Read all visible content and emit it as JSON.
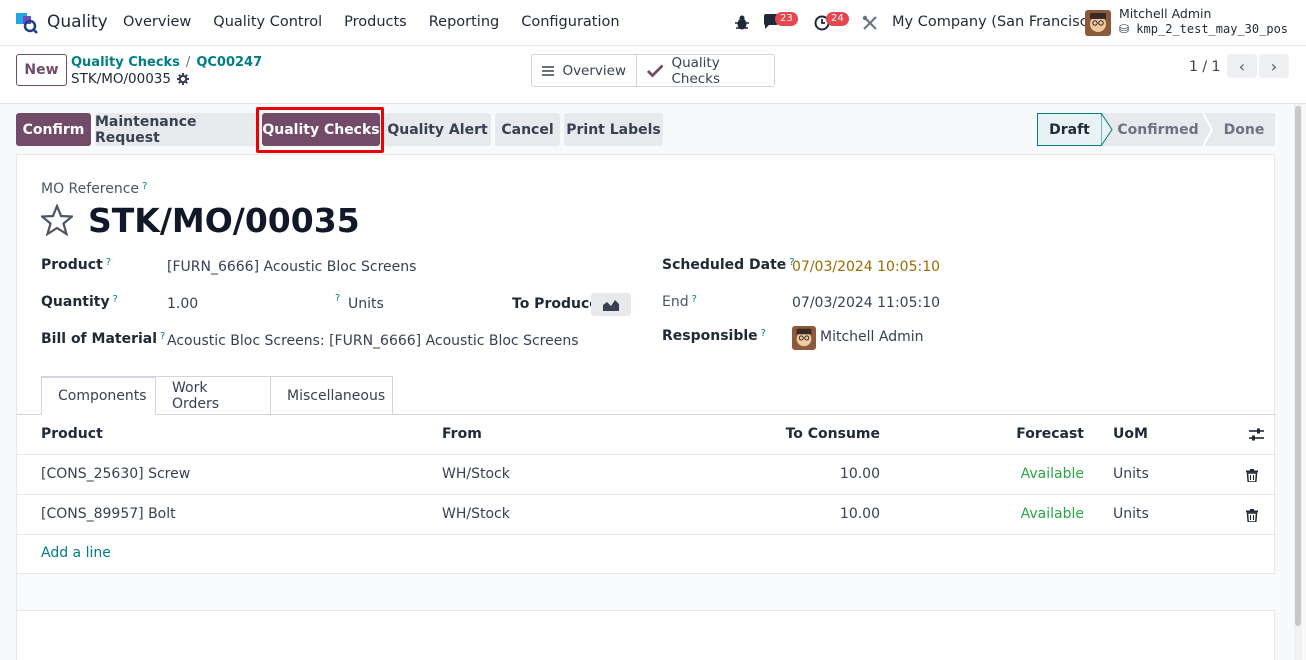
{
  "navbar": {
    "app_name": "Quality",
    "menu": [
      "Overview",
      "Quality Control",
      "Products",
      "Reporting",
      "Configuration"
    ],
    "chat_count": "23",
    "activity_count": "24",
    "company": "My Company (San Francisco)",
    "user_name": "Mitchell Admin",
    "db_name": "kmp_2_test_may_30_pos"
  },
  "control": {
    "new_label": "New",
    "breadcrumb_parent": "Quality Checks",
    "breadcrumb_sep": "/",
    "breadcrumb_current": "QC00247",
    "record": "STK/MO/00035",
    "smart_overview": "Overview",
    "smart_quality_checks": "Quality Checks",
    "pager": "1 / 1"
  },
  "actions": {
    "confirm": "Confirm",
    "maintenance": "Maintenance Request",
    "quality_checks": "Quality Checks",
    "quality_alert": "Quality Alert",
    "cancel": "Cancel",
    "print_labels": "Print Labels"
  },
  "stages": [
    "Draft",
    "Confirmed",
    "Done"
  ],
  "form": {
    "mo_reference_label": "MO Reference",
    "title": "STK/MO/00035",
    "product_label": "Product",
    "product_value": "[FURN_6666] Acoustic Bloc Screens",
    "quantity_label": "Quantity",
    "quantity_value": "1.00",
    "uom_value": "Units",
    "to_produce_label": "To Produce",
    "bom_label": "Bill of Material",
    "bom_value": "Acoustic Bloc Screens: [FURN_6666] Acoustic Bloc Screens",
    "scheduled_label": "Scheduled Date",
    "scheduled_value": "07/03/2024 10:05:10",
    "end_label": "End",
    "end_value": "07/03/2024 11:05:10",
    "responsible_label": "Responsible",
    "responsible_value": "Mitchell Admin",
    "help_mark": "?"
  },
  "tabs": [
    "Components",
    "Work Orders",
    "Miscellaneous"
  ],
  "table": {
    "headers": [
      "Product",
      "From",
      "To Consume",
      "Forecast",
      "UoM"
    ],
    "rows": [
      {
        "product": "[CONS_25630] Screw",
        "from": "WH/Stock",
        "consume": "10.00",
        "forecast": "Available",
        "uom": "Units"
      },
      {
        "product": "[CONS_89957] Bolt",
        "from": "WH/Stock",
        "consume": "10.00",
        "forecast": "Available",
        "uom": "Units"
      }
    ],
    "add_line": "Add a line"
  },
  "colors": {
    "brand": "#714b67",
    "link": "#017e84",
    "available": "#28a745",
    "badge": "#e6464e",
    "highlight": "#e00000"
  }
}
